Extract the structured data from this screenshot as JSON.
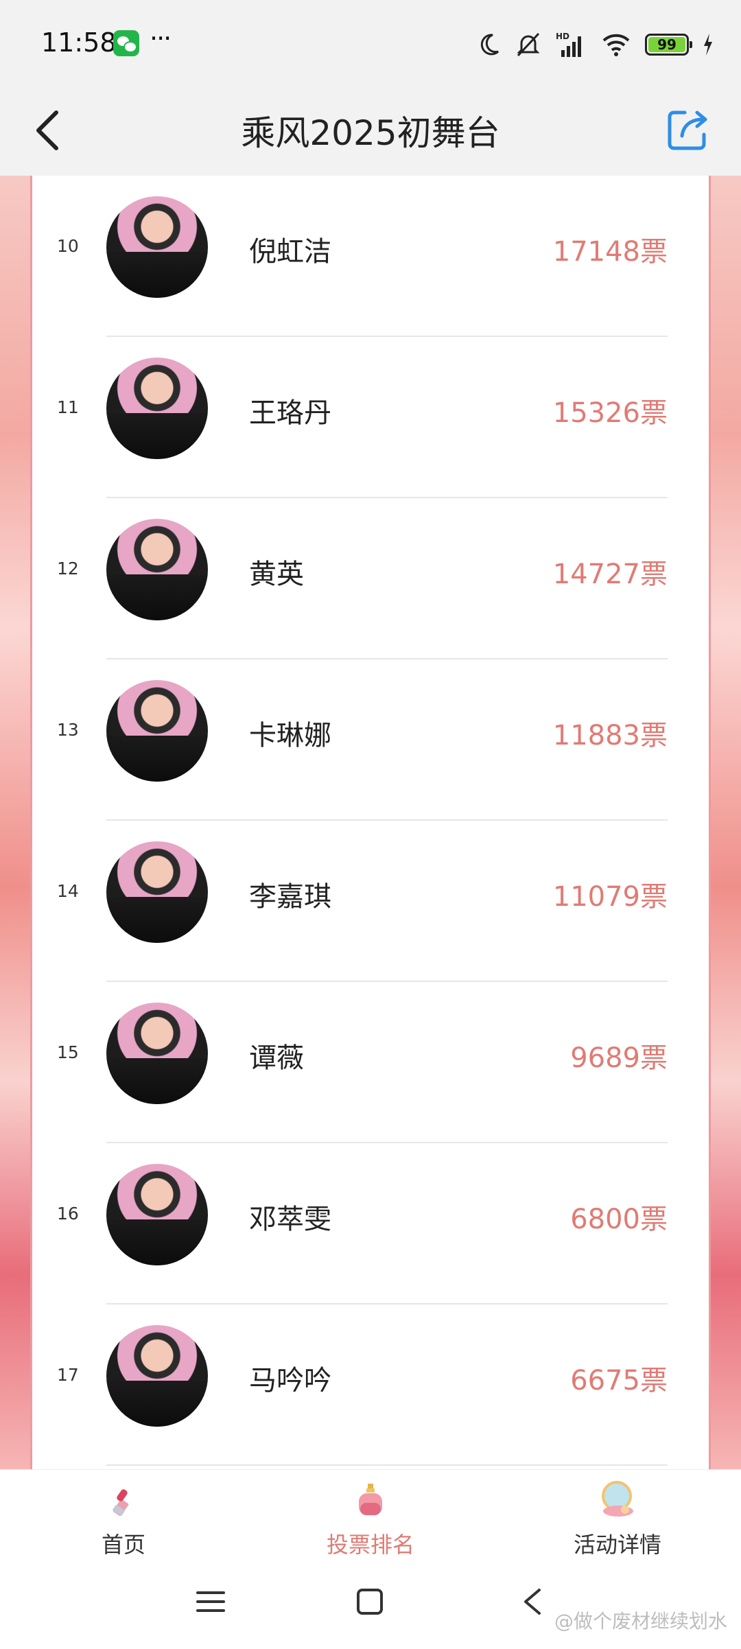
{
  "status_bar": {
    "time": "11:58",
    "more": "···",
    "battery": "99",
    "icons": [
      "wechat-icon",
      "moon-icon",
      "mute-icon",
      "hd-signal-icon",
      "wifi-icon",
      "battery-icon",
      "charging-icon"
    ]
  },
  "header": {
    "title": "乘风2025初舞台",
    "back_icon": "back-icon",
    "share_icon": "share-icon"
  },
  "ranking": [
    {
      "rank": "10",
      "name": "倪虹洁",
      "votes": "17148票"
    },
    {
      "rank": "11",
      "name": "王珞丹",
      "votes": "15326票"
    },
    {
      "rank": "12",
      "name": "黄英",
      "votes": "14727票"
    },
    {
      "rank": "13",
      "name": "卡琳娜",
      "votes": "11883票"
    },
    {
      "rank": "14",
      "name": "李嘉琪",
      "votes": "11079票"
    },
    {
      "rank": "15",
      "name": "谭薇",
      "votes": "9689票"
    },
    {
      "rank": "16",
      "name": "邓萃雯",
      "votes": "6800票"
    },
    {
      "rank": "17",
      "name": "马吟吟",
      "votes": "6675票"
    }
  ],
  "bottom_nav": {
    "items": [
      {
        "label": "首页",
        "icon": "lipstick-icon",
        "active": false
      },
      {
        "label": "投票排名",
        "icon": "perfume-icon",
        "active": true
      },
      {
        "label": "活动详情",
        "icon": "compact-mirror-icon",
        "active": false
      }
    ]
  },
  "colors": {
    "accent": "#e07b74",
    "border": "#ee9aa0"
  },
  "watermark": "@做个废材继续划水"
}
